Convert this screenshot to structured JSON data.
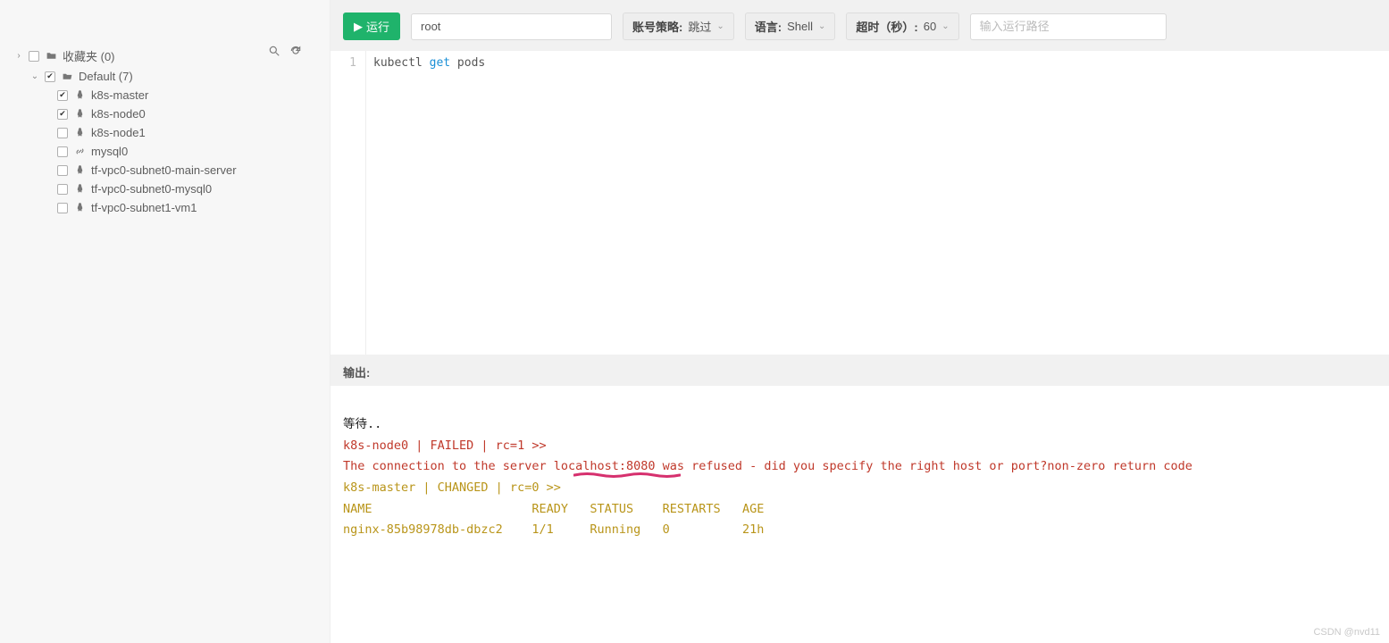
{
  "sidebar": {
    "favorites_label": "收藏夹 (0)",
    "default_label": "Default (7)",
    "items": [
      {
        "label": "k8s-master",
        "checked": true,
        "os": "linux"
      },
      {
        "label": "k8s-node0",
        "checked": true,
        "os": "linux"
      },
      {
        "label": "k8s-node1",
        "checked": false,
        "os": "linux"
      },
      {
        "label": "mysql0",
        "checked": false,
        "os": "link"
      },
      {
        "label": "tf-vpc0-subnet0-main-server",
        "checked": false,
        "os": "linux"
      },
      {
        "label": "tf-vpc0-subnet0-mysql0",
        "checked": false,
        "os": "linux"
      },
      {
        "label": "tf-vpc0-subnet1-vm1",
        "checked": false,
        "os": "linux"
      }
    ]
  },
  "toolbar": {
    "run_label": "运行",
    "root_value": "root",
    "acct_label": "账号策略:",
    "acct_value": "跳过",
    "lang_label": "语言:",
    "lang_value": "Shell",
    "timeout_label": "超时（秒）:",
    "timeout_value": "60",
    "path_placeholder": "输入运行路径"
  },
  "editor": {
    "line_no": "1",
    "code_pre": "kubectl ",
    "code_kw": "get",
    "code_post": " pods"
  },
  "output": {
    "label": "输出:",
    "wait": "等待..",
    "line_fail_header": "k8s-node0 | FAILED | rc=1 >>",
    "line_fail_msg": "The connection to the server localhost:8080 was refused - did you specify the right host or port?non-zero return code",
    "line_ok_header": "k8s-master | CHANGED | rc=0 >>",
    "table_header": "NAME                      READY   STATUS    RESTARTS   AGE",
    "table_row": "nginx-85b98978db-dbzc2    1/1     Running   0          21h"
  },
  "watermark": "CSDN @nvd11"
}
